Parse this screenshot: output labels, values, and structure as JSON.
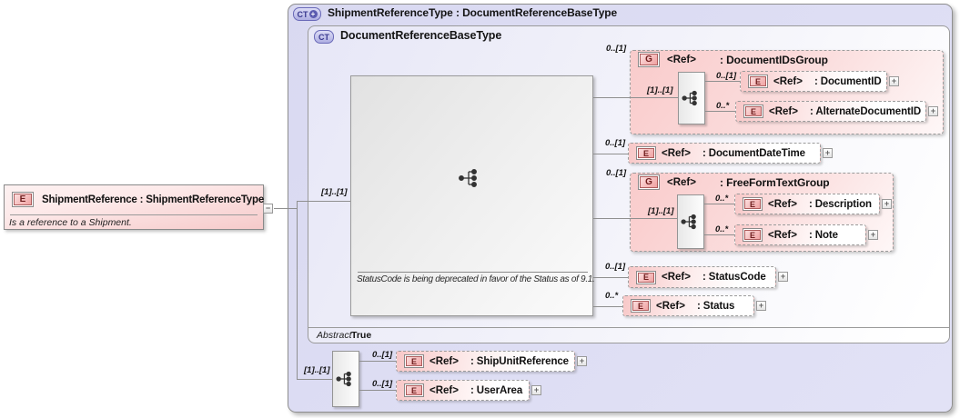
{
  "icons": {
    "element": "E",
    "group": "G",
    "complex_type": "CT",
    "plus": "+",
    "minus": "−"
  },
  "ref_label": "<Ref>",
  "root_element": {
    "title": "ShipmentReference : ShipmentReferenceType",
    "annotation": "Is a reference to a Shipment."
  },
  "outer_container": {
    "title": "ShipmentReferenceType : DocumentReferenceBaseType"
  },
  "inner_container": {
    "title": "DocumentReferenceBaseType",
    "abstract_label": "Abstract",
    "abstract_value": "True"
  },
  "content_model": {
    "cardinality": "[1]..[1]",
    "deprecation_note": "StatusCode is being deprecated in favor of the Status as of 9.1."
  },
  "children": [
    {
      "kind": "group",
      "card": "0..[1]",
      "name": ": DocumentIDsGroup",
      "seq_cardinality": "[1]..[1]",
      "items": [
        {
          "card": "0..[1]",
          "name": ": DocumentID"
        },
        {
          "card": "0..*",
          "name": ": AlternateDocumentID"
        }
      ]
    },
    {
      "kind": "element",
      "card": "0..[1]",
      "name": ": DocumentDateTime"
    },
    {
      "kind": "group",
      "card": "0..[1]",
      "name": ": FreeFormTextGroup",
      "seq_cardinality": "[1]..[1]",
      "items": [
        {
          "card": "0..*",
          "name": ": Description"
        },
        {
          "card": "0..*",
          "name": ": Note"
        }
      ]
    },
    {
      "kind": "element",
      "card": "0..[1]",
      "name": ": StatusCode"
    },
    {
      "kind": "element",
      "card": "0..*",
      "name": ": Status"
    }
  ],
  "extension_model": {
    "cardinality": "[1]..[1]",
    "items": [
      {
        "card": "0..[1]",
        "name": ": ShipUnitReference"
      },
      {
        "card": "0..[1]",
        "name": ": UserArea"
      }
    ]
  },
  "colors": {
    "element_pink": "#f0a2a2",
    "container_lavender": "#dcdcf2",
    "type_icon_blue": "#b0b0e4",
    "line_gray": "#8f8f8f"
  }
}
